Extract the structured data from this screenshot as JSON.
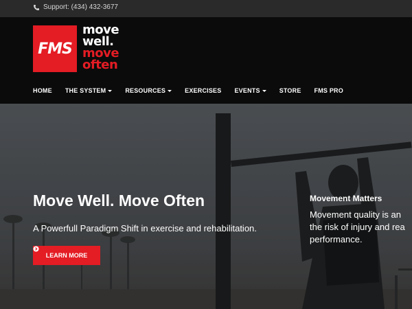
{
  "topbar": {
    "support": "Support: (434) 432-3677"
  },
  "logo": {
    "mark": "FMS",
    "line1": "move",
    "line2": "well.",
    "line3": "move",
    "line4": "often"
  },
  "nav": {
    "items": [
      {
        "label": "HOME",
        "dropdown": false
      },
      {
        "label": "THE SYSTEM",
        "dropdown": true
      },
      {
        "label": "RESOURCES",
        "dropdown": true
      },
      {
        "label": "EXERCISES",
        "dropdown": false
      },
      {
        "label": "EVENTS",
        "dropdown": true
      },
      {
        "label": "STORE",
        "dropdown": false
      },
      {
        "label": "FMS PRO",
        "dropdown": false
      }
    ]
  },
  "hero": {
    "title": "Move Well. Move Often",
    "subtitle": "A Powerfull Paradigm Shift in exercise and rehabilitation.",
    "button": "LEARN MORE"
  },
  "side": {
    "title": "Movement Matters",
    "line1": "Movement quality is an",
    "line2": "the risk of injury and rea",
    "line3": "performance."
  },
  "colors": {
    "accent": "#e41c24",
    "header_bg": "#0b0b0b",
    "topbar_bg": "#2a2a2a"
  },
  "icons": {
    "phone": "phone-icon",
    "arrow": "arrow-circle-right-icon",
    "caret": "caret-down-icon"
  }
}
